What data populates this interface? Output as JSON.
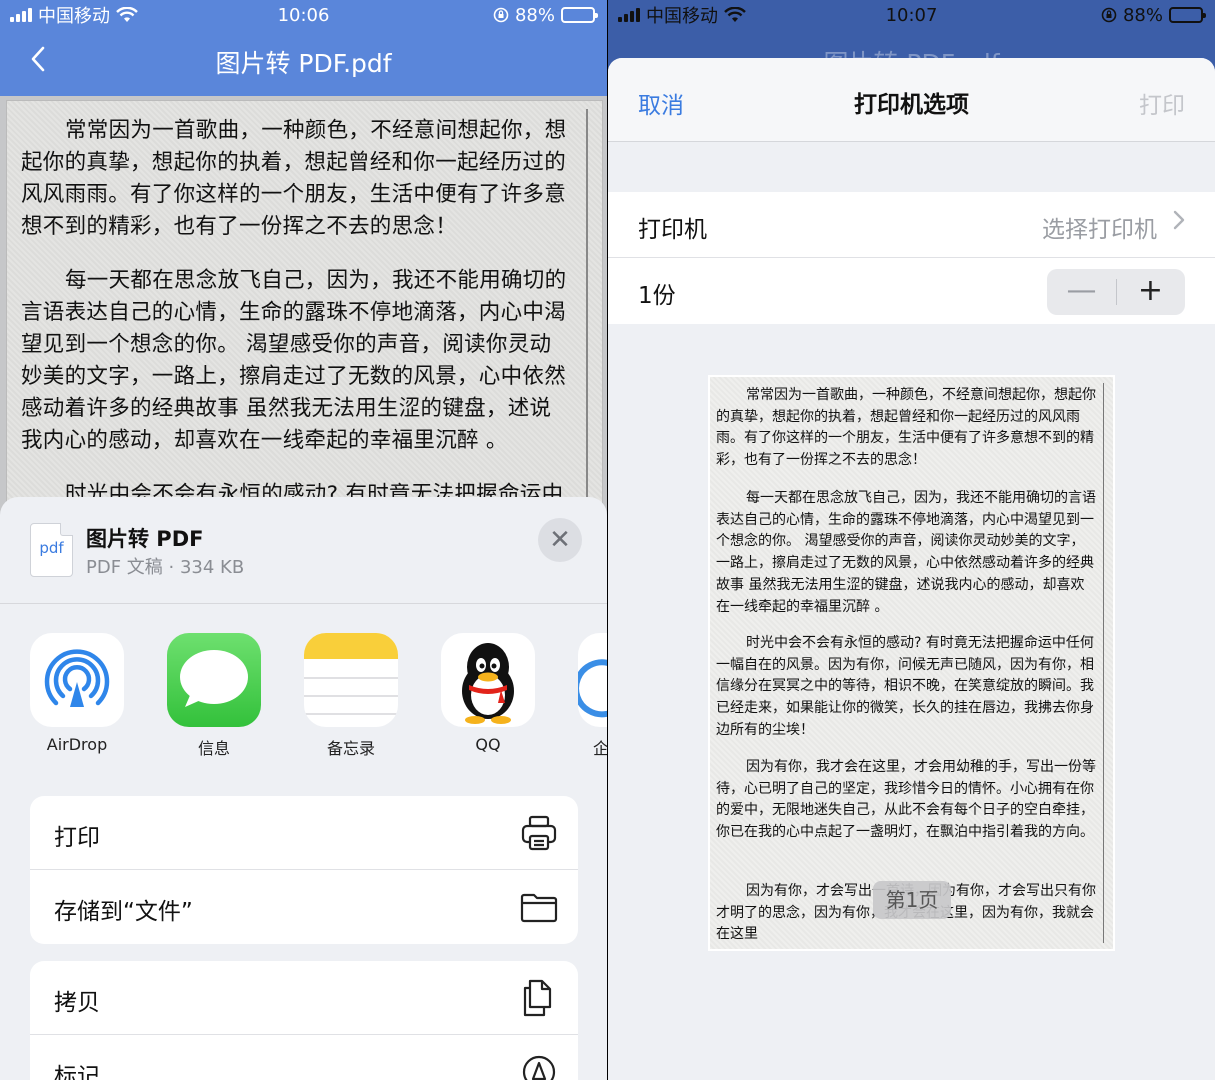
{
  "left": {
    "status": {
      "carrier": "中国移动",
      "time": "10:06",
      "battery": "88%"
    },
    "nav": {
      "title": "图片转 PDF.pdf"
    },
    "document": {
      "p1": "常常因为一首歌曲，一种颜色，不经意间想起你，想起你的真挚，想起你的执着，想起曾经和你一起经历过的风风雨雨。有了你这样的一个朋友，生活中便有了许多意想不到的精彩，也有了一份挥之不去的思念！",
      "p2": "每一天都在思念放飞自己，因为，我还不能用确切的言语表达自己的心情，生命的露珠不停地滴落，内心中渴望见到一个想念的你。 渴望感受你的声音，阅读你灵动妙美的文字，一路上，擦肩走过了无数的风景，心中依然感动着许多的经典故事 虽然我无法用生涩的键盘，述说我内心的感动，却喜欢在一线牵起的幸福里沉醉 。",
      "p3": "时光中会不会有永恒的感动? 有时竟无法把握命运中"
    },
    "share": {
      "file_name": "图片转 PDF",
      "file_meta": "PDF 文稿 · 334 KB",
      "file_icon_label": "pdf",
      "close_label": "✕",
      "apps": [
        {
          "label": "AirDrop",
          "icon": "airdrop-icon"
        },
        {
          "label": "信息",
          "icon": "messages-icon"
        },
        {
          "label": "备忘录",
          "icon": "notes-icon"
        },
        {
          "label": "QQ",
          "icon": "qq-icon"
        },
        {
          "label": "企",
          "icon": "enterprise-app-icon"
        }
      ],
      "actions_group1": [
        {
          "label": "打印",
          "icon": "printer-icon"
        },
        {
          "label": "存储到“文件”",
          "icon": "folder-icon"
        }
      ],
      "actions_group2": [
        {
          "label": "拷贝",
          "icon": "copy-icon"
        },
        {
          "label": "标记",
          "icon": "markup-icon"
        }
      ]
    }
  },
  "right": {
    "status": {
      "carrier": "中国移动",
      "time": "10:07",
      "battery": "88%"
    },
    "underlying_title": "图片转 PDF.pdf",
    "modal": {
      "cancel": "取消",
      "title": "打印机选项",
      "print": "打印",
      "printer_label": "打印机",
      "printer_value": "选择打印机",
      "copies_label": "1份",
      "minus": "—",
      "plus": "+"
    },
    "preview": {
      "q1": "常常因为一首歌曲，一种颜色，不经意间想起你，想起你的真挚，想起你的执着，想起曾经和你一起经历过的风风雨雨。有了你这样的一个朋友，生活中便有了许多意想不到的精彩，也有了一份挥之不去的思念！",
      "q2": "每一天都在思念放飞自己，因为，我还不能用确切的言语表达自己的心情，生命的露珠不停地滴落，内心中渴望见到一个想念的你。 渴望感受你的声音，阅读你灵动妙美的文字，一路上，擦肩走过了无数的风景，心中依然感动着许多的经典故事 虽然我无法用生涩的键盘，述说我内心的感动，却喜欢在一线牵起的幸福里沉醉 。",
      "q3": "时光中会不会有永恒的感动? 有时竟无法把握命运中任何一幅自在的风景。因为有你，问候无声已随风，因为有你，相信缘分在冥冥之中的等待，相识不晚，在笑意绽放的瞬间。我已经走来，如果能让你的微笑，长久的挂在唇边，我拂去你身边所有的尘埃！",
      "q4": "因为有你，我才会在这里，才会用幼稚的手，写出一份等待，心已明了自己的坚定，我珍惜今日的情怀。小心拥有在你的爱中，无限地迷失自己，从此不会有每个日子的空白牵挂，你已在我的心中点起了一盏明灯，在飘泊中指引着我的方向。",
      "q5": "因为有你，才会写出一首诗，因为有你，才会写出只有你才明了的思念，因为有你，我才会在这里，因为有你，我就会在这里",
      "page_badge": "第1页"
    }
  },
  "colors": {
    "nav_blue": "#5a86da",
    "ios_blue": "#3a7be0",
    "sheet_bg": "#eef0f4"
  }
}
